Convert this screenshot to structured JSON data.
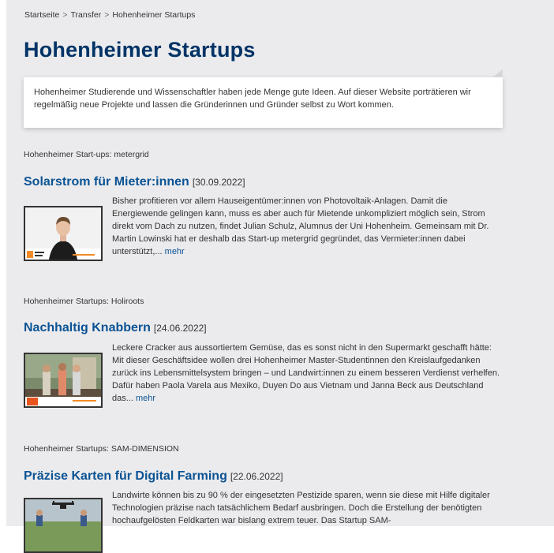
{
  "breadcrumb": [
    "Startseite",
    "Transfer",
    "Hohenheimer Startups"
  ],
  "breadcrumb_sep": ">",
  "page_title": "Hohenheimer Startups",
  "intro": "Hohenheimer Studierende und Wissenschaftler haben jede Menge gute Ideen. Auf dieser Website porträtieren wir regelmäßig neue Projekte und lassen die Gründerinnen und Gründer selbst zu Wort kommen.",
  "articles": [
    {
      "kicker": "Hohenheimer Start-ups: metergrid",
      "title": "Solarstrom für Mieter:innen",
      "date": "[30.09.2022]",
      "text": "Bisher profitieren vor allem Hauseigentümer:innen von Photovoltaik-Anlagen. Damit die Energiewende gelingen kann, muss es aber auch für Mietende unkompliziert möglich sein, Strom direkt vom Dach zu nutzen, findet Julian Schulz, Alumnus der Uni Hohenheim. Gemeinsam mit Dr. Martin Lowinski hat er deshalb das Start-up metergrid gegründet, das Vermieter:innen dabei unterstützt,...",
      "more": "mehr"
    },
    {
      "kicker": "Hohenheimer Startups: Holiroots",
      "title": "Nachhaltig Knabbern",
      "date": "[24.06.2022]",
      "text": "Leckere Cracker aus aussortiertem Gemüse, das es sonst nicht in den Supermarkt geschafft hätte: Mit dieser Geschäftsidee wollen drei Hohenheimer Master-Studentinnen den Kreislaufgedanken zurück ins Lebensmittelsystem bringen – und Landwirt:innen zu einem besseren Verdienst verhelfen. Dafür haben Paola Varela aus Mexiko, Duyen Do aus Vietnam und Janna Beck aus Deutschland das...",
      "more": "mehr"
    },
    {
      "kicker": "Hohenheimer Startups: SAM-DIMENSION",
      "title": "Präzise Karten für Digital Farming",
      "date": "[22.06.2022]",
      "text": "Landwirte können bis zu 90 % der eingesetzten Pestizide sparen, wenn sie diese mit Hilfe digitaler Technologien präzise nach tatsächlichem Bedarf ausbringen. Doch die Erstellung der benötigten hochaufgelösten Feldkarten war bislang extrem teuer. Das Startup SAM-",
      "more": ""
    }
  ],
  "colors": {
    "title": "#003366",
    "link": "#0b5394",
    "background": "#ebebed",
    "accent": "#f28c28"
  },
  "icons": [
    "startup-badge-icon",
    "drone-icon"
  ]
}
